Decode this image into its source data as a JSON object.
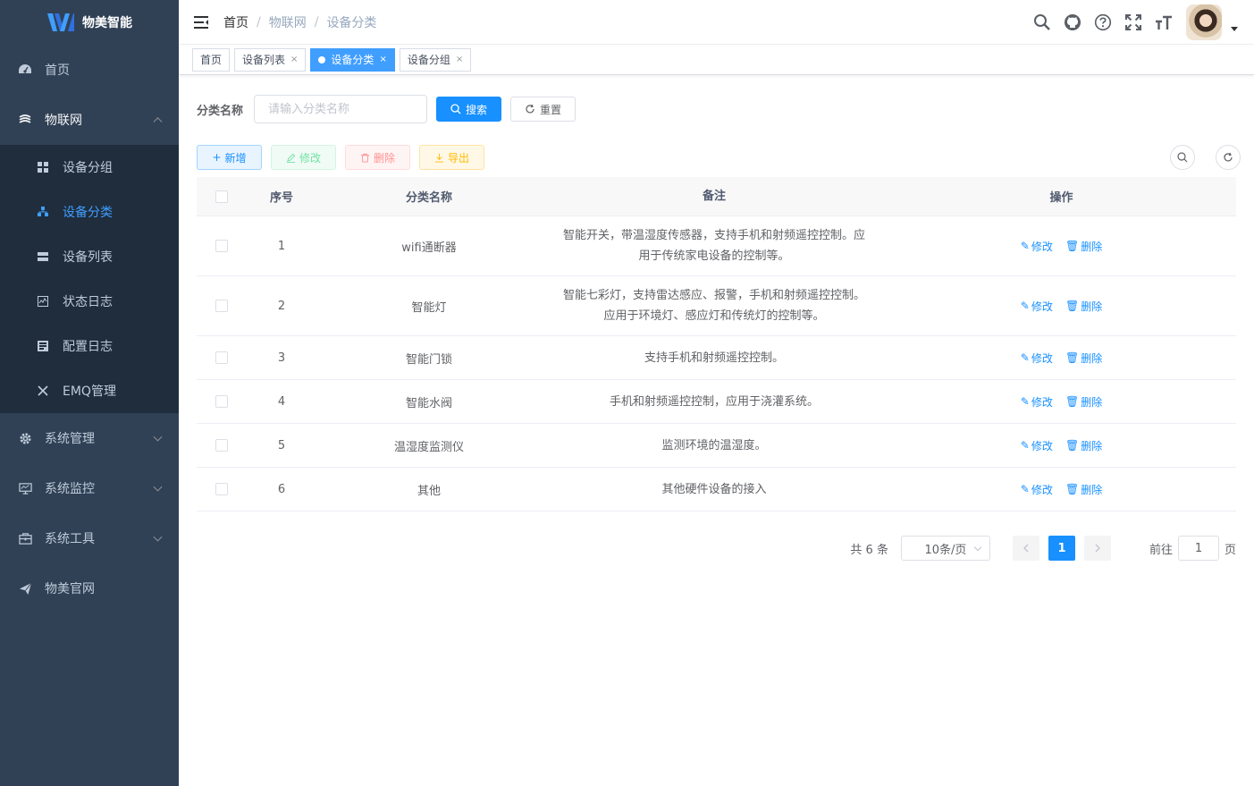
{
  "app": {
    "name": "物美智能"
  },
  "sidebar": {
    "items": [
      {
        "label": "首页",
        "icon": "dashboard-icon"
      },
      {
        "label": "物联网",
        "icon": "iot-icon",
        "open": true,
        "children": [
          {
            "label": "设备分组",
            "icon": "grid-icon"
          },
          {
            "label": "设备分类",
            "icon": "tree-icon",
            "active": true
          },
          {
            "label": "设备列表",
            "icon": "list-icon"
          },
          {
            "label": "状态日志",
            "icon": "monitor-log-icon"
          },
          {
            "label": "配置日志",
            "icon": "form-log-icon"
          },
          {
            "label": "EMQ管理",
            "icon": "plug-icon"
          }
        ]
      },
      {
        "label": "系统管理",
        "icon": "gear-icon"
      },
      {
        "label": "系统监控",
        "icon": "monitor-icon"
      },
      {
        "label": "系统工具",
        "icon": "toolbox-icon"
      },
      {
        "label": "物美官网",
        "icon": "paper-plane-icon"
      }
    ]
  },
  "breadcrumb": [
    "首页",
    "物联网",
    "设备分类"
  ],
  "tags": [
    {
      "label": "首页"
    },
    {
      "label": "设备列表"
    },
    {
      "label": "设备分类",
      "active": true
    },
    {
      "label": "设备分组"
    }
  ],
  "search": {
    "label": "分类名称",
    "placeholder": "请输入分类名称",
    "search_btn": "搜索",
    "reset_btn": "重置"
  },
  "toolbar": {
    "add": "新增",
    "edit": "修改",
    "delete": "删除",
    "export": "导出"
  },
  "table": {
    "headers": [
      "序号",
      "分类名称",
      "备注",
      "操作"
    ],
    "rows": [
      {
        "idx": "1",
        "name": "wifi通断器",
        "note": [
          "智能开关，带温湿度传感器，支持手机和射频遥控控制。应",
          "用于传统家电设备的控制等。"
        ]
      },
      {
        "idx": "2",
        "name": "智能灯",
        "note": [
          "智能七彩灯，支持雷达感应、报警，手机和射频遥控控制。",
          "应用于环境灯、感应灯和传统灯的控制等。"
        ]
      },
      {
        "idx": "3",
        "name": "智能门锁",
        "note": [
          "支持手机和射频遥控控制。"
        ]
      },
      {
        "idx": "4",
        "name": "智能水阀",
        "note": [
          "手机和射频遥控控制，应用于浇灌系统。"
        ]
      },
      {
        "idx": "5",
        "name": "温湿度监测仪",
        "note": [
          "监测环境的温湿度。"
        ]
      },
      {
        "idx": "6",
        "name": "其他",
        "note": [
          "其他硬件设备的接入"
        ]
      }
    ],
    "op_edit": "修改",
    "op_delete": "删除"
  },
  "pagination": {
    "total_text": "共 6 条",
    "page_size": "10条/页",
    "current": "1",
    "goto_prefix": "前往",
    "goto_value": "1",
    "goto_suffix": "页"
  },
  "colors": {
    "primary": "#1890ff",
    "sidebar_bg": "#304156",
    "submenu_bg": "#1f2d3d"
  }
}
